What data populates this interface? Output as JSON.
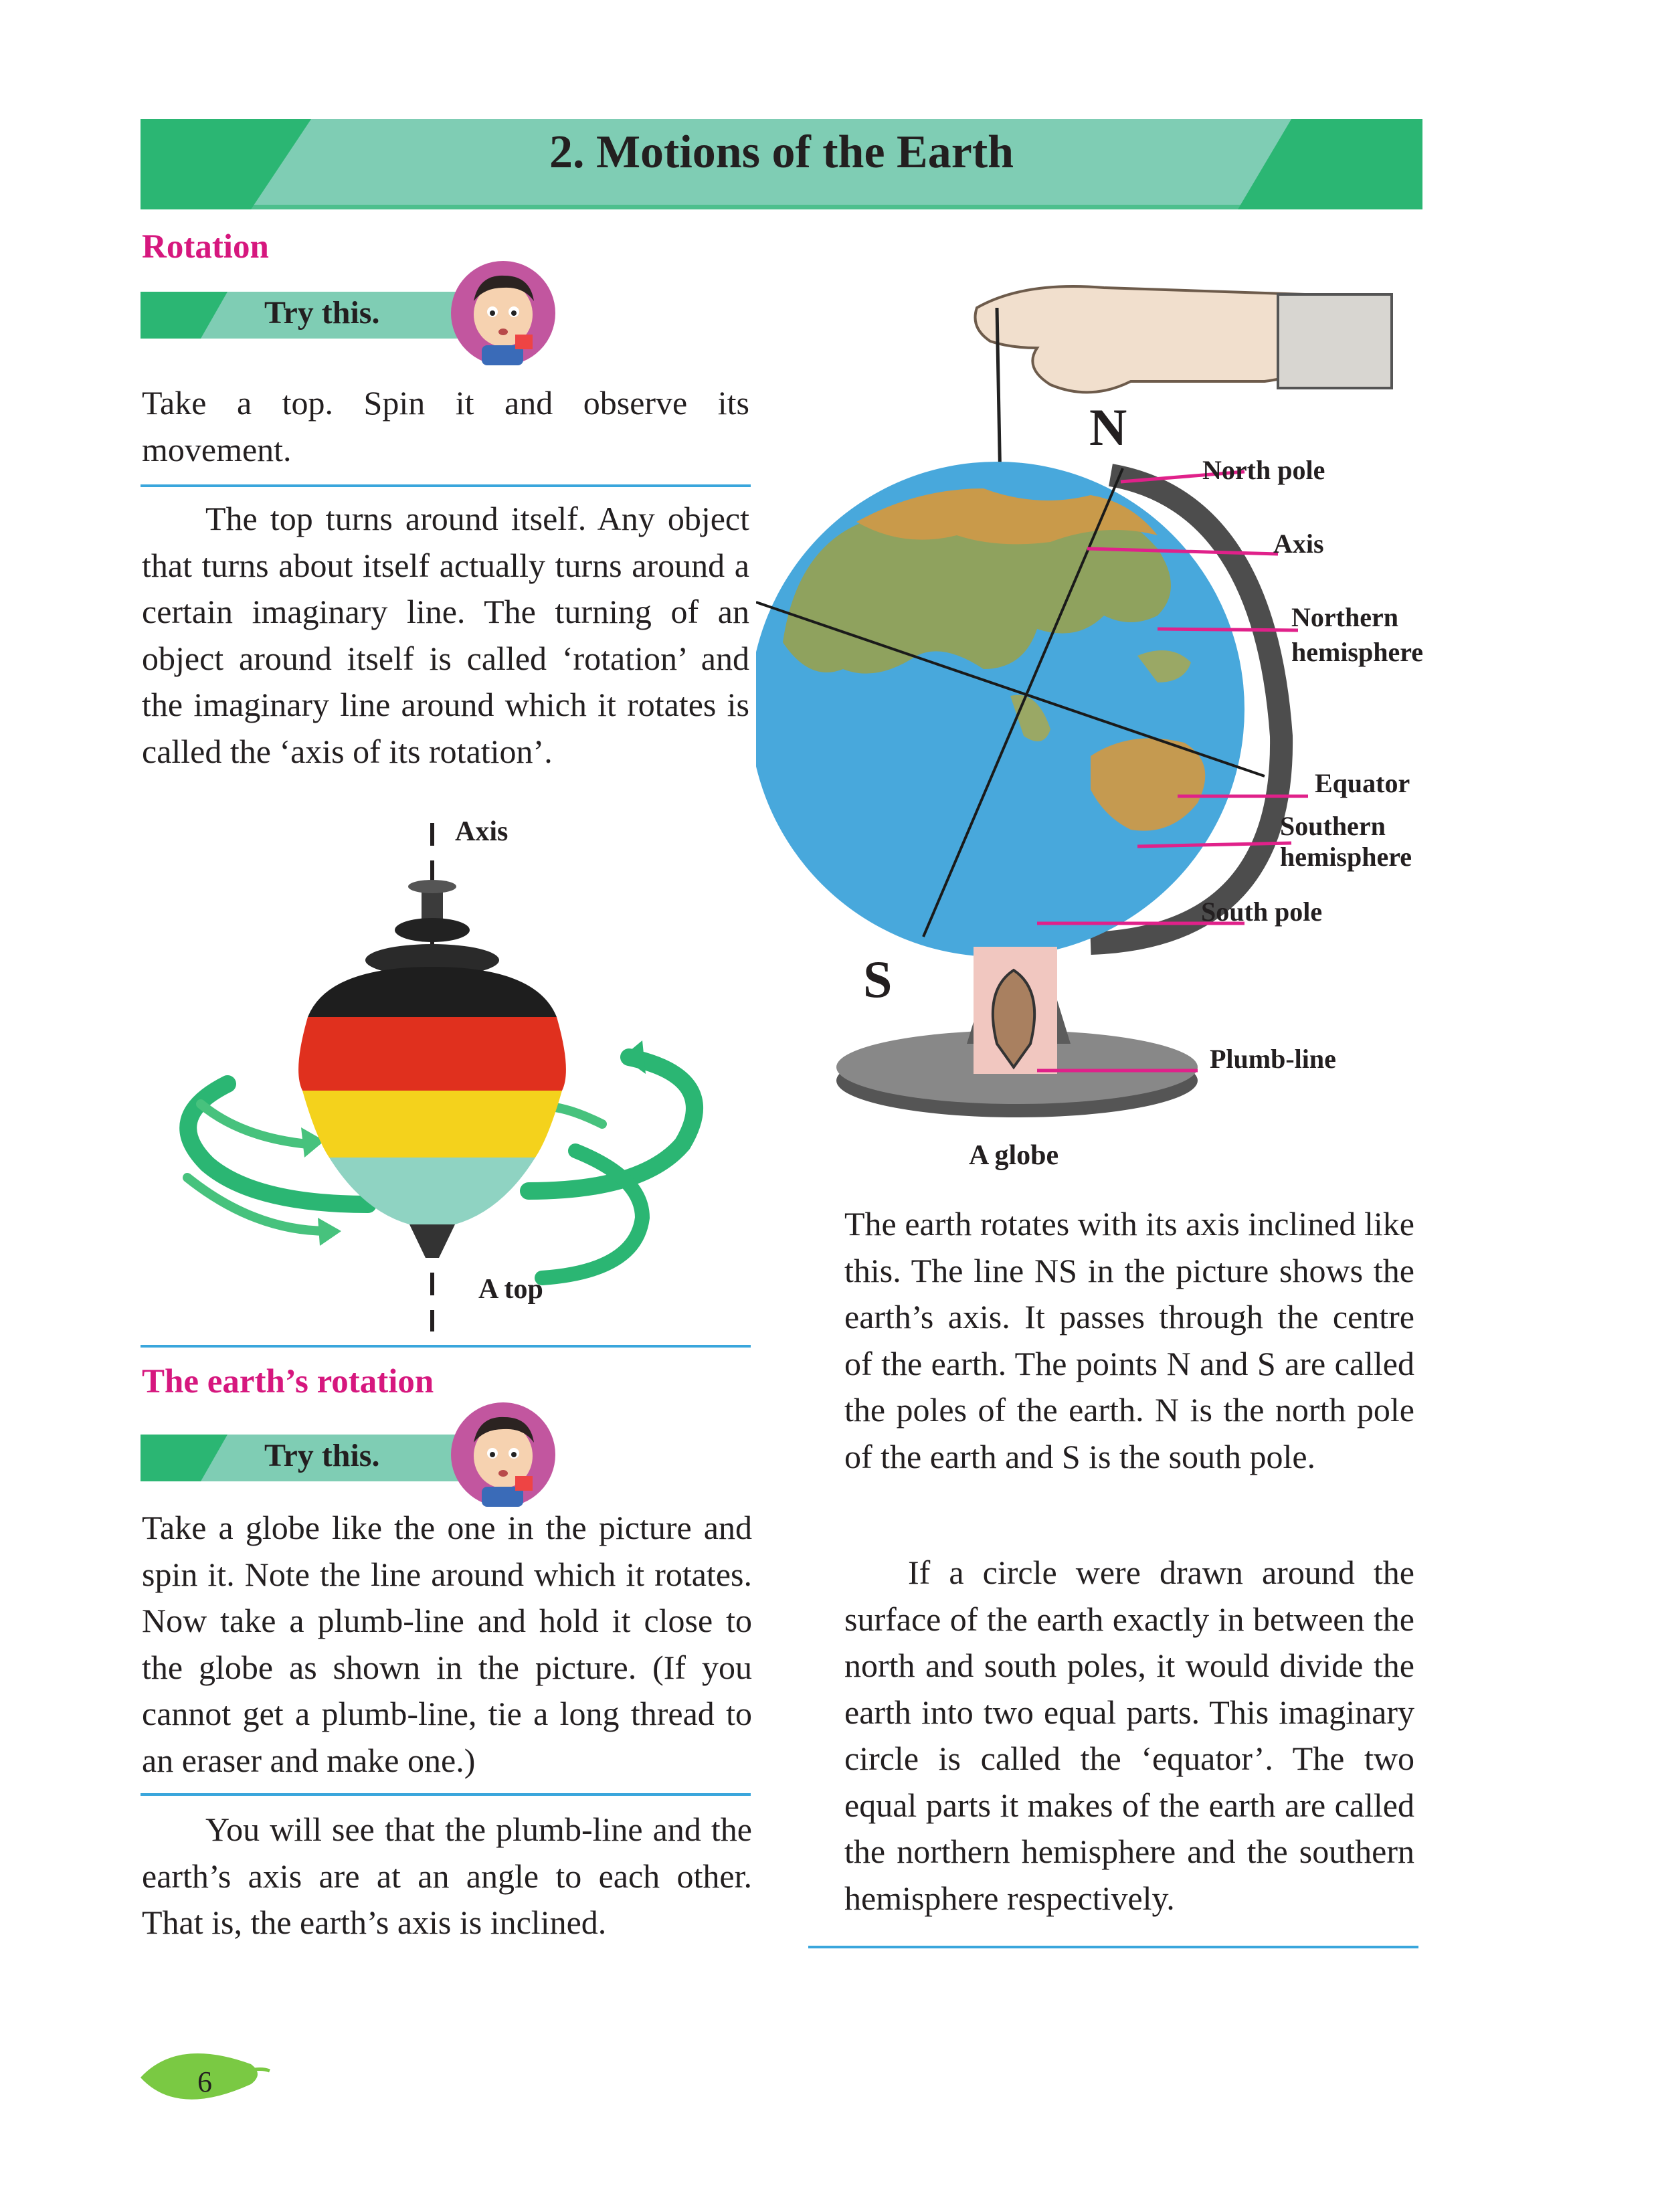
{
  "chapter_title": "2. Motions of the Earth",
  "section_rotation": "Rotation",
  "try_this_1": "Try this.",
  "activity_1": "Take a top. Spin it and observe its movement.",
  "para_rotation": "The top turns around itself. Any object that turns about itself actually turns around a certain imaginary line. The turning of an object around itself is called ‘rotation’ and the imaginary line around which it rotates is called the ‘axis of its rotation’.",
  "top_figure": {
    "axis_label": "Axis",
    "caption": "A top"
  },
  "section_earth_rotation": "The earth’s rotation",
  "try_this_2": "Try this.",
  "activity_2": "Take a globe like the one in the picture and spin it. Note the line around which it rotates. Now take a plumb-line and hold it close to the globe as shown in the picture. (If you cannot get a plumb-line, tie a long thread to an eraser and make one.)",
  "para_plumb": "You will see that the plumb-line and the earth’s axis are at an angle to each other. That is, the earth’s axis is inclined.",
  "globe_figure": {
    "letter_n": "N",
    "letter_s": "S",
    "labels": {
      "north_pole": "North pole",
      "axis": "Axis",
      "northern_1": "Northern",
      "northern_2": "hemisphere",
      "equator": "Equator",
      "southern_1": "Southern",
      "southern_2": "hemisphere",
      "south_pole": "South pole",
      "plumb_line": "Plumb-line"
    },
    "caption": "A globe"
  },
  "para_axis": "The earth rotates with its axis inclined like this. The line NS in the picture shows the earth’s axis. It passes through the centre of the earth. The points N and S are called the poles of the earth. N is the north pole of the earth and S is the south pole.",
  "para_equator": "If a circle were drawn around the surface of the earth exactly in between the north and south poles, it would divide the earth into two equal parts. This imaginary circle is called the ‘equator’. The two equal parts it makes of the earth are called the northern hemisphere and the southern hemisphere respectively.",
  "page_number": "6",
  "colors": {
    "accent_green": "#2bb673",
    "banner_green": "#7fcdb4",
    "heading_pink": "#d6177e",
    "rule_blue": "#3aa6dc",
    "label_line": "#e0218a"
  }
}
